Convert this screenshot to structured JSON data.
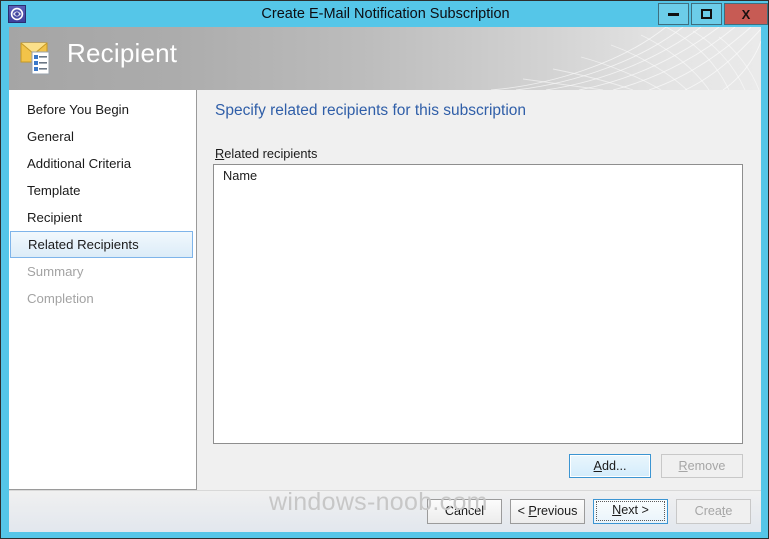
{
  "window": {
    "title": "Create E-Mail Notification Subscription",
    "icon": "subscription-icon",
    "controls": {
      "minimize": "minimize-icon",
      "maximize": "maximize-icon",
      "close": "X"
    }
  },
  "banner": {
    "title": "Recipient",
    "icon": "email-checklist-icon"
  },
  "sidebar": {
    "items": [
      {
        "label": "Before You Begin",
        "state": "normal"
      },
      {
        "label": "General",
        "state": "normal"
      },
      {
        "label": "Additional Criteria",
        "state": "normal"
      },
      {
        "label": "Template",
        "state": "normal"
      },
      {
        "label": "Recipient",
        "state": "normal"
      },
      {
        "label": "Related Recipients",
        "state": "selected"
      },
      {
        "label": "Summary",
        "state": "disabled"
      },
      {
        "label": "Completion",
        "state": "disabled"
      }
    ]
  },
  "content": {
    "heading": "Specify related recipients for this subscription",
    "field_label_accel": "R",
    "field_label_rest": "elated recipients",
    "listview": {
      "columns": [
        "Name"
      ],
      "rows": []
    },
    "actions": {
      "add_accel": "A",
      "add_rest": "dd...",
      "remove_accel": "R",
      "remove_rest": "emove",
      "remove_disabled": true
    }
  },
  "footer": {
    "cancel": "Cancel",
    "previous_prefix": "< ",
    "previous_accel": "P",
    "previous_rest": "revious",
    "next_accel": "N",
    "next_rest": "ext >",
    "create_pre": "Crea",
    "create_accel": "t",
    "create_rest": "e",
    "create_disabled": true
  },
  "watermark": "windows-noob.com",
  "colors": {
    "titlebar": "#55c6e8",
    "close_button": "#c75b54",
    "heading_blue": "#2f5ea8",
    "selection_border": "#7eb4ea",
    "focus_border": "#3c95d2"
  }
}
